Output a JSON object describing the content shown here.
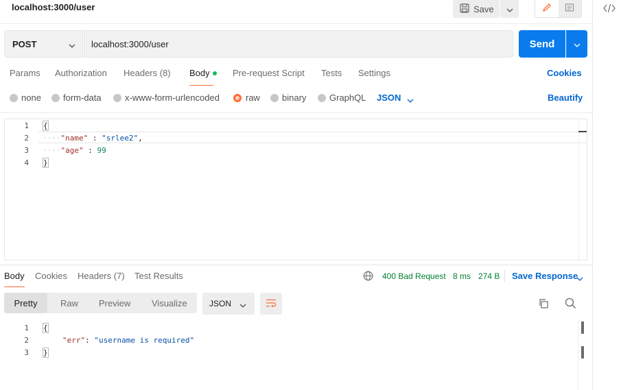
{
  "header": {
    "request_title": "localhost:3000/user",
    "save_label": "Save",
    "icons": [
      "save-icon",
      "chevron-down-icon",
      "pencil-icon",
      "document-icon",
      "code-icon"
    ]
  },
  "request": {
    "method": "POST",
    "url": "localhost:3000/user",
    "send_label": "Send"
  },
  "request_tabs": {
    "items": [
      {
        "label": "Params"
      },
      {
        "label": "Authorization"
      },
      {
        "label": "Headers (8)"
      },
      {
        "label": "Body",
        "active": true
      },
      {
        "label": "Pre-request Script"
      },
      {
        "label": "Tests"
      },
      {
        "label": "Settings"
      }
    ],
    "cookies_label": "Cookies"
  },
  "body_types": {
    "options": [
      {
        "label": "none"
      },
      {
        "label": "form-data"
      },
      {
        "label": "x-www-form-urlencoded"
      },
      {
        "label": "raw",
        "selected": true
      },
      {
        "label": "binary"
      },
      {
        "label": "GraphQL"
      }
    ],
    "format": "JSON",
    "beautify_label": "Beautify"
  },
  "request_body": {
    "line_numbers": [
      "1",
      "2",
      "3",
      "4"
    ],
    "lines": {
      "l1": "{",
      "l2_key": "\"name\"",
      "l2_sep": " : ",
      "l2_val": "\"srlee2\"",
      "l2_end": ",",
      "l3_key": "\"age\"",
      "l3_sep": " : ",
      "l3_val": "99",
      "l4": "}"
    }
  },
  "response": {
    "tabs": [
      {
        "label": "Body",
        "active": true
      },
      {
        "label": "Cookies"
      },
      {
        "label": "Headers (7)"
      },
      {
        "label": "Test Results"
      }
    ],
    "status": "400 Bad Request",
    "time": "8 ms",
    "size": "274 B",
    "save_response_label": "Save Response",
    "view_tabs": [
      {
        "label": "Pretty",
        "active": true
      },
      {
        "label": "Raw"
      },
      {
        "label": "Preview"
      },
      {
        "label": "Visualize"
      }
    ],
    "format": "JSON",
    "line_numbers": [
      "1",
      "2",
      "3"
    ],
    "lines": {
      "l1": "{",
      "l2_key": "\"err\"",
      "l2_sep": ": ",
      "l2_val": "\"username is required\"",
      "l3": "}"
    }
  },
  "colors": {
    "accent_orange": "#ff6c37",
    "send_blue": "#097bed",
    "link_blue": "#0265d2",
    "status_green": "#007f31",
    "dot_green": "#0cbb52"
  }
}
